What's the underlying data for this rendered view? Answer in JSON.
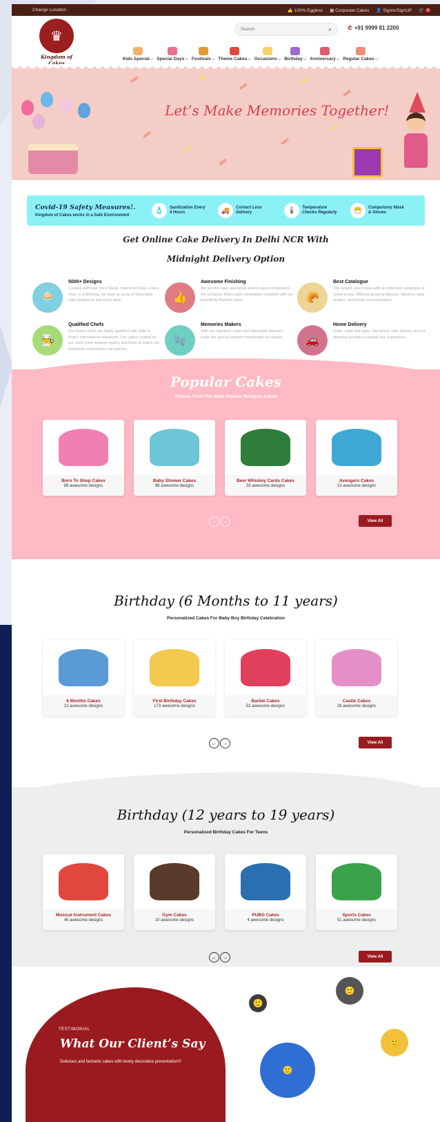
{
  "topbar": {
    "location": "Change Location",
    "eggless": "100% Eggless",
    "corporate": "Corporate Cakes",
    "signin": "Signin/SignUP",
    "cart_count": "0"
  },
  "header": {
    "logo_name": "Kingdom of Cakes",
    "search_placeholder": "Search",
    "phone": "+91 9999 81 2200",
    "nav": [
      {
        "label": "Kids Special",
        "color": "#f6b26b"
      },
      {
        "label": "Special Days",
        "color": "#ea6f8a"
      },
      {
        "label": "Festivals",
        "color": "#e59a38"
      },
      {
        "label": "Theme Cakes",
        "color": "#d94b3d"
      },
      {
        "label": "Occasions",
        "color": "#f3d26a"
      },
      {
        "label": "Birthday",
        "color": "#9c6bd0"
      },
      {
        "label": "Anniversary",
        "color": "#e15b6f"
      },
      {
        "label": "Regular Cakes",
        "color": "#ef8f7a"
      }
    ]
  },
  "hero": {
    "headline": "Let’s Make Memories Together!"
  },
  "safety": {
    "title": "Covid-19 Safety Measures!.",
    "subtitle": "Kingdom of Cakes works in a Safe Environment",
    "items": [
      {
        "label": "Sanitization Every 4 Hours",
        "icon": "sanitizer-icon"
      },
      {
        "label": "Contact Less Delivery",
        "icon": "delivery-icon"
      },
      {
        "label": "Temperature Checks Regularly",
        "icon": "thermometer-icon"
      },
      {
        "label": "Compulsory Mask & Gloves",
        "icon": "mask-icon"
      }
    ]
  },
  "intro": {
    "line1": "Get Online Cake Delivery In Delhi NCR With",
    "line2": "Midnight Delivery Option"
  },
  "features": [
    {
      "title": "5000+ Designs",
      "text": "Curated with love, be it Diwali, Valentine's Day, a New Year, or a Birthday, we have an array of delectable cake designs to suit every taste.",
      "color": "#7fd0e0",
      "icon": "cupcake-icon"
    },
    {
      "title": "Awesome Finishing",
      "text": "We are the cake specialists where cakes compliment the occasion. Make each celebration complete with our beautifully finished cakes.",
      "color": "#e07b84",
      "icon": "thumbs-up-icon"
    },
    {
      "title": "Best Catalogue",
      "text": "The largest cake house with an extensive catalogue of sweet treats. Offering amazing flavours, fabulous cake shapes, and dream customisations.",
      "color": "#ecd595",
      "icon": "croissant-icon"
    },
    {
      "title": "Qualified Chefs",
      "text": "Our expert chefs are highly qualified with skills to match international standards. The cakes created by our chefs have superior quality and finish to match the standards expected by our patrons.",
      "color": "#a6dc78",
      "icon": "chef-hat-icon"
    },
    {
      "title": "Memories Makers",
      "text": "With our signature cakes and delectable flavours, make the special moment memorable for always.",
      "color": "#6fcfc0",
      "icon": "glove-icon"
    },
    {
      "title": "Home Delivery",
      "text": "Order, relax and enjoy. Our timely cake delivery at your doorstep provides a hassle free experience.",
      "color": "#d2738e",
      "icon": "car-icon"
    }
  ],
  "popular": {
    "title": "Popular Cakes",
    "subtitle": "Choose From The Most Popular Designer Cakes",
    "view_all": "View All",
    "cards": [
      {
        "name": "Born To Shop Cakes",
        "count": "88 awesome designs",
        "color": "#f07fb2"
      },
      {
        "name": "Baby Shower Cakes",
        "count": "98 awesome designs",
        "color": "#6cc6d8"
      },
      {
        "name": "Beer Whiskey Cards Cakes",
        "count": "33 awesome designs",
        "color": "#2e7d3a"
      },
      {
        "name": "Avengers Cakes",
        "count": "13 awesome designs",
        "color": "#3fa7d6"
      }
    ]
  },
  "birthday_young": {
    "title": "Birthday (6 Months to 11 years)",
    "subtitle": "Personalized Cakes For Baby Boy Birthday Celebration",
    "view_all": "View All",
    "cards": [
      {
        "name": "6 Months Cakes",
        "count": "13 awesome designs",
        "color": "#5b9bd5"
      },
      {
        "name": "First Birthday Cakes",
        "count": "173 awesome designs",
        "color": "#f2c94c"
      },
      {
        "name": "Barbie Cakes",
        "count": "52 awesome designs",
        "color": "#e0405c"
      },
      {
        "name": "Castle Cakes",
        "count": "26 awesome designs",
        "color": "#e58fc9"
      }
    ]
  },
  "birthday_teen": {
    "title": "Birthday (12 years to 19 years)",
    "subtitle": "Personalized Birthday Cakes For Teens",
    "view_all": "View All",
    "cards": [
      {
        "name": "Musical Instrument Cakes",
        "count": "45 awesome designs",
        "color": "#e0483e"
      },
      {
        "name": "Gym Cakes",
        "count": "10 awesome designs",
        "color": "#5a3a2a"
      },
      {
        "name": "PUBG Cakes",
        "count": "4 awesome designs",
        "color": "#2a6fb0"
      },
      {
        "name": "Sports Cakes",
        "count": "51 awesome designs",
        "color": "#3aa24b"
      }
    ]
  },
  "testimonial": {
    "label": "TESTIMONIAL",
    "title": "What Our Client’s Say",
    "subtitle": "Delicious and fantastic cakes with lovely decorative presentation!!!"
  }
}
